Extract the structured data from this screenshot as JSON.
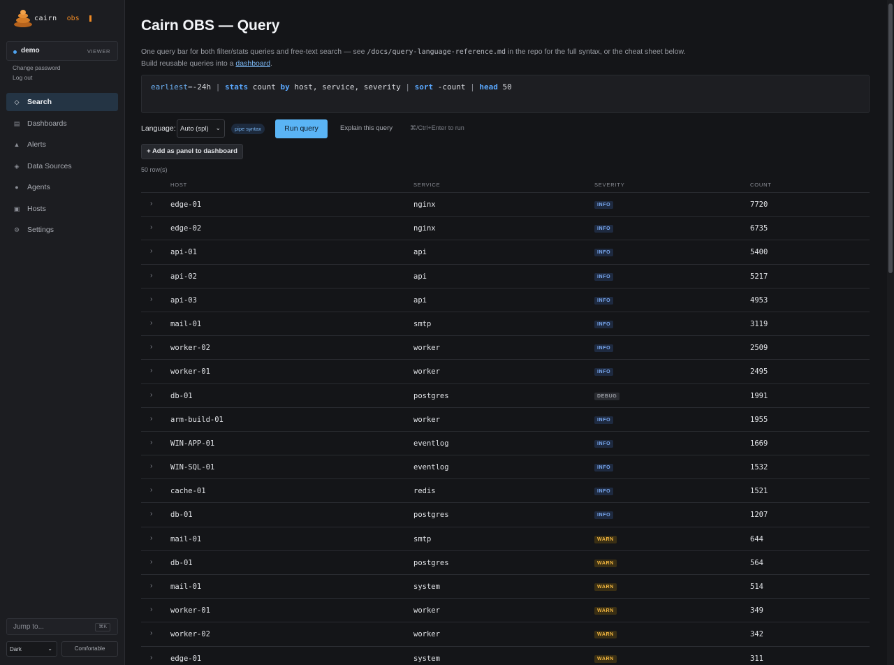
{
  "brand": {
    "name": "cairn",
    "suffix": "obs"
  },
  "user": {
    "name": "demo",
    "role": "VIEWER"
  },
  "account_links": {
    "change_password": "Change password",
    "logout": "Log out"
  },
  "nav": [
    {
      "label": "Search",
      "icon": "diamond-icon",
      "glyph": "◇",
      "active": true
    },
    {
      "label": "Dashboards",
      "icon": "dashboard-icon",
      "glyph": "▤",
      "active": false
    },
    {
      "label": "Alerts",
      "icon": "alert-icon",
      "glyph": "▲",
      "active": false
    },
    {
      "label": "Data Sources",
      "icon": "data-source-icon",
      "glyph": "◈",
      "active": false
    },
    {
      "label": "Agents",
      "icon": "agent-icon",
      "glyph": "●",
      "active": false
    },
    {
      "label": "Hosts",
      "icon": "host-icon",
      "glyph": "▣",
      "active": false
    },
    {
      "label": "Settings",
      "icon": "gear-icon",
      "glyph": "⚙",
      "active": false
    }
  ],
  "jump": {
    "label": "Jump to...",
    "shortcut": "⌘K"
  },
  "theme": {
    "selected": "Dark"
  },
  "density": {
    "label": "Comfortable"
  },
  "page": {
    "title": "Cairn OBS — Query",
    "desc_pre": "One query bar for both filter/stats queries and free-text search — see ",
    "desc_code": "/docs/query-language-reference.md",
    "desc_mid": " in the repo for the full syntax, or the cheat sheet below. Build reusable queries into a ",
    "desc_link": "dashboard",
    "desc_post": "."
  },
  "query": {
    "text": "earliest=-24h | stats count by host, service, severity | sort -count | head 50"
  },
  "controls": {
    "language_label": "Language:",
    "language_selected": "Auto (spl)",
    "syntax_badge": "pipe syntax",
    "run_label": "Run query",
    "explain_label": "Explain this query",
    "hint": "⌘/Ctrl+Enter to run",
    "add_panel_label": "+ Add as panel to dashboard",
    "row_count": "50 row(s)"
  },
  "colors": {
    "accent": "#5ab4f5",
    "brand": "#f08a24",
    "info": "#7aa8f0",
    "warn": "#f2b640",
    "debug": "#9a9da4"
  },
  "table": {
    "columns": [
      "HOST",
      "SERVICE",
      "SEVERITY",
      "COUNT"
    ],
    "rows": [
      {
        "host": "edge-01",
        "service": "nginx",
        "severity": "INFO",
        "count": "7720"
      },
      {
        "host": "edge-02",
        "service": "nginx",
        "severity": "INFO",
        "count": "6735"
      },
      {
        "host": "api-01",
        "service": "api",
        "severity": "INFO",
        "count": "5400"
      },
      {
        "host": "api-02",
        "service": "api",
        "severity": "INFO",
        "count": "5217"
      },
      {
        "host": "api-03",
        "service": "api",
        "severity": "INFO",
        "count": "4953"
      },
      {
        "host": "mail-01",
        "service": "smtp",
        "severity": "INFO",
        "count": "3119"
      },
      {
        "host": "worker-02",
        "service": "worker",
        "severity": "INFO",
        "count": "2509"
      },
      {
        "host": "worker-01",
        "service": "worker",
        "severity": "INFO",
        "count": "2495"
      },
      {
        "host": "db-01",
        "service": "postgres",
        "severity": "DEBUG",
        "count": "1991"
      },
      {
        "host": "arm-build-01",
        "service": "worker",
        "severity": "INFO",
        "count": "1955"
      },
      {
        "host": "WIN-APP-01",
        "service": "eventlog",
        "severity": "INFO",
        "count": "1669"
      },
      {
        "host": "WIN-SQL-01",
        "service": "eventlog",
        "severity": "INFO",
        "count": "1532"
      },
      {
        "host": "cache-01",
        "service": "redis",
        "severity": "INFO",
        "count": "1521"
      },
      {
        "host": "db-01",
        "service": "postgres",
        "severity": "INFO",
        "count": "1207"
      },
      {
        "host": "mail-01",
        "service": "smtp",
        "severity": "WARN",
        "count": "644"
      },
      {
        "host": "db-01",
        "service": "postgres",
        "severity": "WARN",
        "count": "564"
      },
      {
        "host": "mail-01",
        "service": "system",
        "severity": "WARN",
        "count": "514"
      },
      {
        "host": "worker-01",
        "service": "worker",
        "severity": "WARN",
        "count": "349"
      },
      {
        "host": "worker-02",
        "service": "worker",
        "severity": "WARN",
        "count": "342"
      },
      {
        "host": "edge-01",
        "service": "system",
        "severity": "WARN",
        "count": "311"
      }
    ]
  }
}
